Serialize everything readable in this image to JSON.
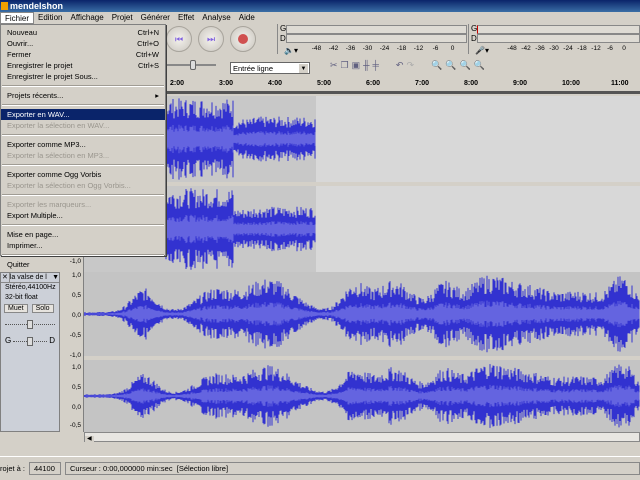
{
  "window": {
    "title": "mendelshon"
  },
  "menubar": [
    "Fichier",
    "Edition",
    "Affichage",
    "Projet",
    "Générer",
    "Effet",
    "Analyse",
    "Aide"
  ],
  "file_menu": [
    {
      "label": "Nouveau",
      "shortcut": "Ctrl+N",
      "enabled": true
    },
    {
      "label": "Ouvrir...",
      "shortcut": "Ctrl+O",
      "enabled": true
    },
    {
      "label": "Fermer",
      "shortcut": "Ctrl+W",
      "enabled": true
    },
    {
      "label": "Enregistrer le projet",
      "shortcut": "Ctrl+S",
      "enabled": true
    },
    {
      "label": "Enregistrer le projet Sous...",
      "shortcut": "",
      "enabled": true
    },
    {
      "sep": true
    },
    {
      "label": "Projets récents...",
      "shortcut": "▸",
      "enabled": true
    },
    {
      "sep": true
    },
    {
      "label": "Exporter en WAV...",
      "shortcut": "",
      "enabled": true,
      "highlighted": true
    },
    {
      "label": "Exporter la sélection en WAV...",
      "shortcut": "",
      "enabled": false
    },
    {
      "sep": true
    },
    {
      "label": "Exporter comme MP3...",
      "shortcut": "",
      "enabled": true
    },
    {
      "label": "Exporter la sélection en MP3...",
      "shortcut": "",
      "enabled": false
    },
    {
      "sep": true
    },
    {
      "label": "Exporter comme Ogg Vorbis",
      "shortcut": "",
      "enabled": true
    },
    {
      "label": "Exporter la sélection en Ogg Vorbis...",
      "shortcut": "",
      "enabled": false
    },
    {
      "sep": true
    },
    {
      "label": "Exporter les marqueurs...",
      "shortcut": "",
      "enabled": false
    },
    {
      "label": "Export Multiple...",
      "shortcut": "",
      "enabled": true
    },
    {
      "sep": true
    },
    {
      "label": "Mise en page...",
      "shortcut": "",
      "enabled": true
    },
    {
      "label": "Imprimer...",
      "shortcut": "",
      "enabled": true
    },
    {
      "sep": true
    },
    {
      "label": "Quitter",
      "shortcut": "",
      "enabled": true
    }
  ],
  "meters": {
    "left_label": "G",
    "right_label": "D",
    "ticks": [
      "-48",
      "-42",
      "-36",
      "-30",
      "-24",
      "-18",
      "-12",
      "-6",
      "0"
    ]
  },
  "input_source": "Entrée ligne",
  "ruler": [
    "2:00",
    "3:00",
    "4:00",
    "5:00",
    "6:00",
    "7:00",
    "8:00",
    "9:00",
    "10:00",
    "11:00"
  ],
  "track2": {
    "name": "la valse de l",
    "format": "Stéréo,44100Hz",
    "depth": "32-bit float",
    "mute": "Muet",
    "solo": "Solo",
    "pan_left": "G",
    "pan_right": "D"
  },
  "scale_labels": [
    "1,0",
    "0,5",
    "0,0",
    "-0,5",
    "-1,0"
  ],
  "status": {
    "rate_label": "rojet à :",
    "rate": "44100",
    "cursor": "Curseur : 0:00,000000 min:sec",
    "mode": "[Sélection libre]"
  },
  "colors": {
    "wave": "#3232d0",
    "wave_rms": "#6464e0",
    "menu_highlight": "#0a246a"
  }
}
